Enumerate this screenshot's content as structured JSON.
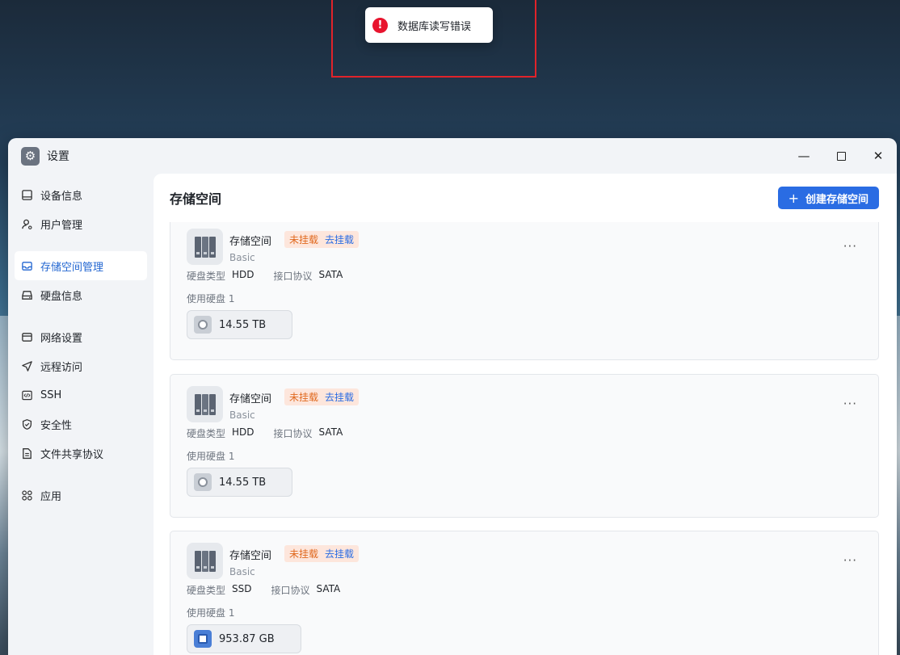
{
  "toast": {
    "message": "数据库读写错误",
    "icon": "error-icon"
  },
  "window": {
    "title": "设置",
    "controls": [
      "minimize",
      "maximize",
      "close"
    ]
  },
  "sidebar": {
    "items": [
      {
        "label": "设备信息",
        "icon": "device-info-icon"
      },
      {
        "label": "用户管理",
        "icon": "user-icon"
      },
      {
        "label": "存储空间管理",
        "icon": "storage-icon",
        "active": true
      },
      {
        "label": "硬盘信息",
        "icon": "disk-icon"
      },
      {
        "label": "网络设置",
        "icon": "network-icon"
      },
      {
        "label": "远程访问",
        "icon": "remote-access-icon"
      },
      {
        "label": "SSH",
        "icon": "ssh-code-icon"
      },
      {
        "label": "安全性",
        "icon": "shield-icon"
      },
      {
        "label": "文件共享协议",
        "icon": "document-icon"
      },
      {
        "label": "应用",
        "icon": "apps-grid-icon"
      }
    ]
  },
  "main": {
    "title": "存储空间",
    "create_button": "创建存储空间",
    "cards": [
      {
        "name": "存储空间",
        "status": "未挂载",
        "action": "去挂载",
        "type": "Basic",
        "disk_type_label": "硬盘类型",
        "disk_type": "HDD",
        "protocol_label": "接口协议",
        "protocol": "SATA",
        "disks_label": "使用硬盘 1",
        "disk_size": "14.55 TB"
      },
      {
        "name": "存储空间",
        "status": "未挂载",
        "action": "去挂载",
        "type": "Basic",
        "disk_type_label": "硬盘类型",
        "disk_type": "HDD",
        "protocol_label": "接口协议",
        "protocol": "SATA",
        "disks_label": "使用硬盘 1",
        "disk_size": "14.55 TB"
      },
      {
        "name": "存储空间",
        "status": "未挂载",
        "action": "去挂载",
        "type": "Basic",
        "disk_type_label": "硬盘类型",
        "disk_type": "SSD",
        "protocol_label": "接口协议",
        "protocol": "SATA",
        "disks_label": "使用硬盘 1",
        "disk_size": "953.87 GB"
      }
    ]
  },
  "colors": {
    "accent": "#2a6ce3",
    "error": "#e8142e",
    "status_warning": "#e0691f",
    "badge_bg": "#fde6dc"
  }
}
